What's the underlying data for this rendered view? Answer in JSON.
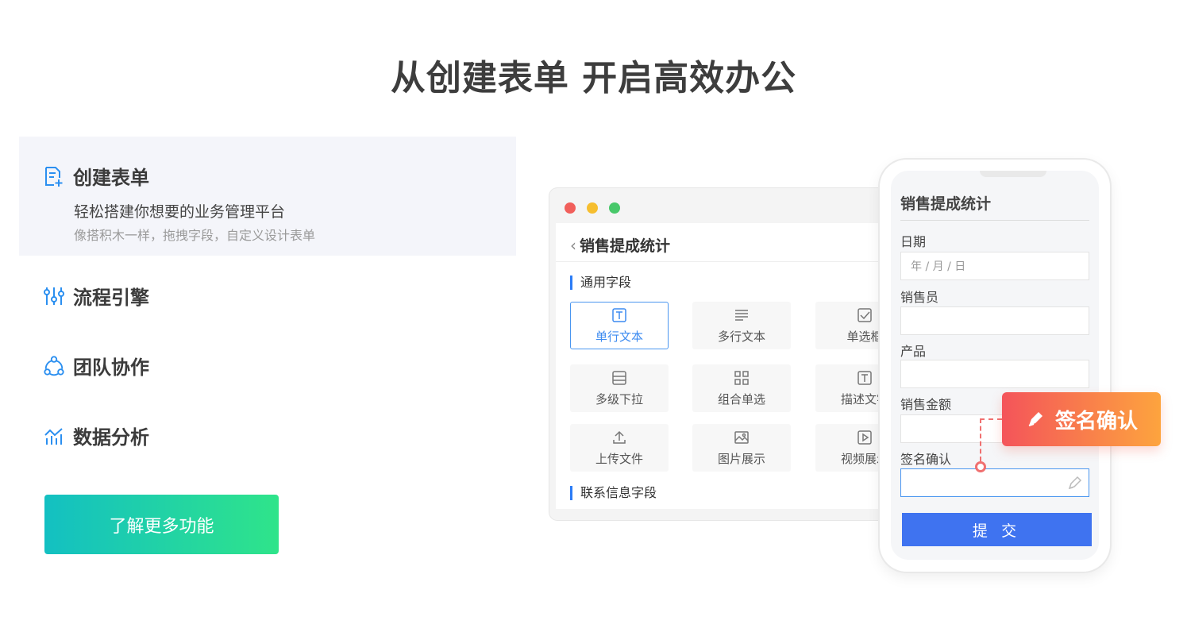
{
  "hero": {
    "title": "从创建表单  开启高效办公"
  },
  "features": [
    {
      "title": "创建表单",
      "icon": "form-add-icon",
      "desc": "轻松搭建你想要的业务管理平台",
      "sub": "像搭积木一样，拖拽字段，自定义设计表单",
      "active": true
    },
    {
      "title": "流程引擎",
      "icon": "sliders-icon"
    },
    {
      "title": "团队协作",
      "icon": "team-network-icon"
    },
    {
      "title": "数据分析",
      "icon": "chart-line-icon"
    }
  ],
  "cta": {
    "label": "了解更多功能"
  },
  "window": {
    "title": "销售提成统计",
    "section_common": "通用字段",
    "section_contact": "联系信息字段",
    "fields": [
      {
        "label": "单行文本",
        "icon": "text-field-icon"
      },
      {
        "label": "多行文本",
        "icon": "multiline-text-icon"
      },
      {
        "label": "单选框",
        "icon": "checkbox-icon"
      },
      {
        "label": "多级下拉",
        "icon": "dropdown-icon"
      },
      {
        "label": "组合单选",
        "icon": "grid-icon"
      },
      {
        "label": "描述文字",
        "icon": "description-icon"
      },
      {
        "label": "上传文件",
        "icon": "upload-icon"
      },
      {
        "label": "图片展示",
        "icon": "image-icon"
      },
      {
        "label": "视频展示",
        "icon": "video-icon"
      }
    ]
  },
  "phone": {
    "title": "销售提成统计",
    "date_label": "日期",
    "date_placeholder": "年 / 月 / 日",
    "salesperson_label": "销售员",
    "product_label": "产品",
    "amount_label": "销售金额",
    "signature_label": "签名确认",
    "submit_label": "提 交"
  },
  "callout": {
    "label": "签名确认"
  },
  "colors": {
    "accent": "#3f73f0",
    "cta_start": "#13c0c2",
    "cta_end": "#2fe48a",
    "callout_start": "#f4545a",
    "callout_end": "#fda43e",
    "icon_blue": "#2b8ff0"
  }
}
